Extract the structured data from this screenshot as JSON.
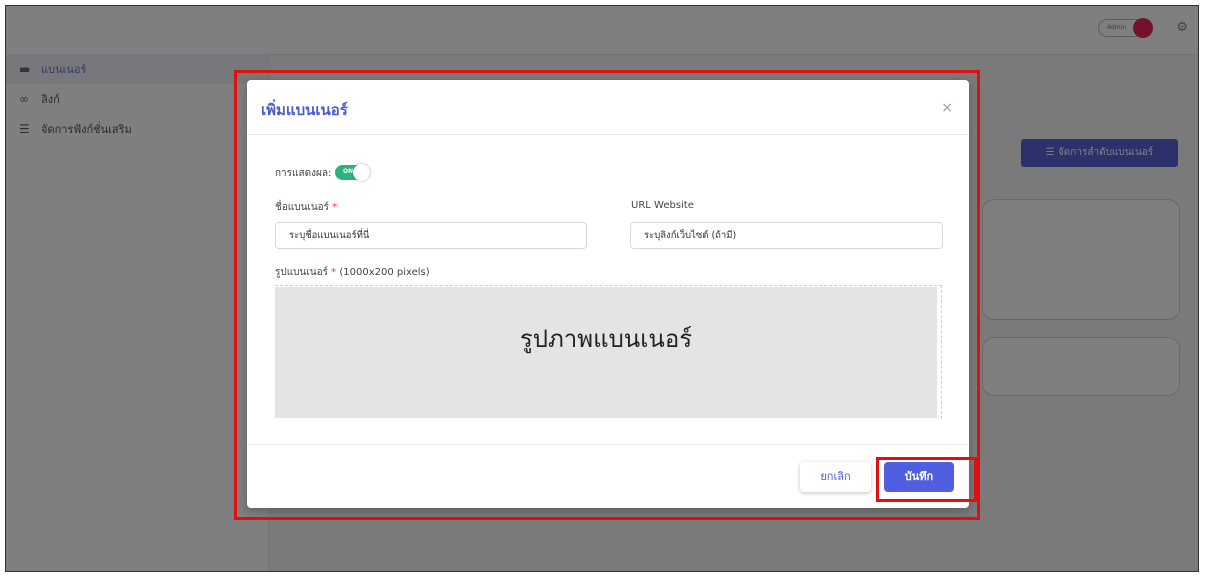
{
  "admin_label": "Admin",
  "sidebar": {
    "items": [
      {
        "label": "แบนเนอร์",
        "icon": "image-icon",
        "glyph": "▬",
        "active": true
      },
      {
        "label": "ลิงก์",
        "icon": "link-icon",
        "glyph": "∞",
        "active": false
      },
      {
        "label": "จัดการฟังก์ชั่นเสริม",
        "icon": "sliders-icon",
        "glyph": "☰",
        "active": false
      }
    ]
  },
  "content": {
    "reorder_button": "☰ จัดการลำดับแบนเนอร์"
  },
  "modal": {
    "title": "เพิ่มแบนเนอร์",
    "close": "×",
    "display_label": "การแสดงผล:",
    "toggle_text": "ON",
    "name_label": "ชื่อแบนเนอร์",
    "name_placeholder": "ระบุชื่อแบนเนอร์ที่นี่",
    "url_label": "URL Website",
    "url_placeholder": "ระบุลิงก์เว็บไซต์ (ถ้ามี)",
    "image_label": "รูปแบนเนอร์",
    "image_hint": " (1000x200 pixels)",
    "required_mark": "*",
    "image_placeholder": "รูปภาพแบนเนอร์",
    "cancel_label": "ยกเลิก",
    "save_label": "บันทึก"
  },
  "colors": {
    "primary": "#4f5fe0",
    "toggle_on": "#2db37f",
    "highlight": "#e01010"
  }
}
